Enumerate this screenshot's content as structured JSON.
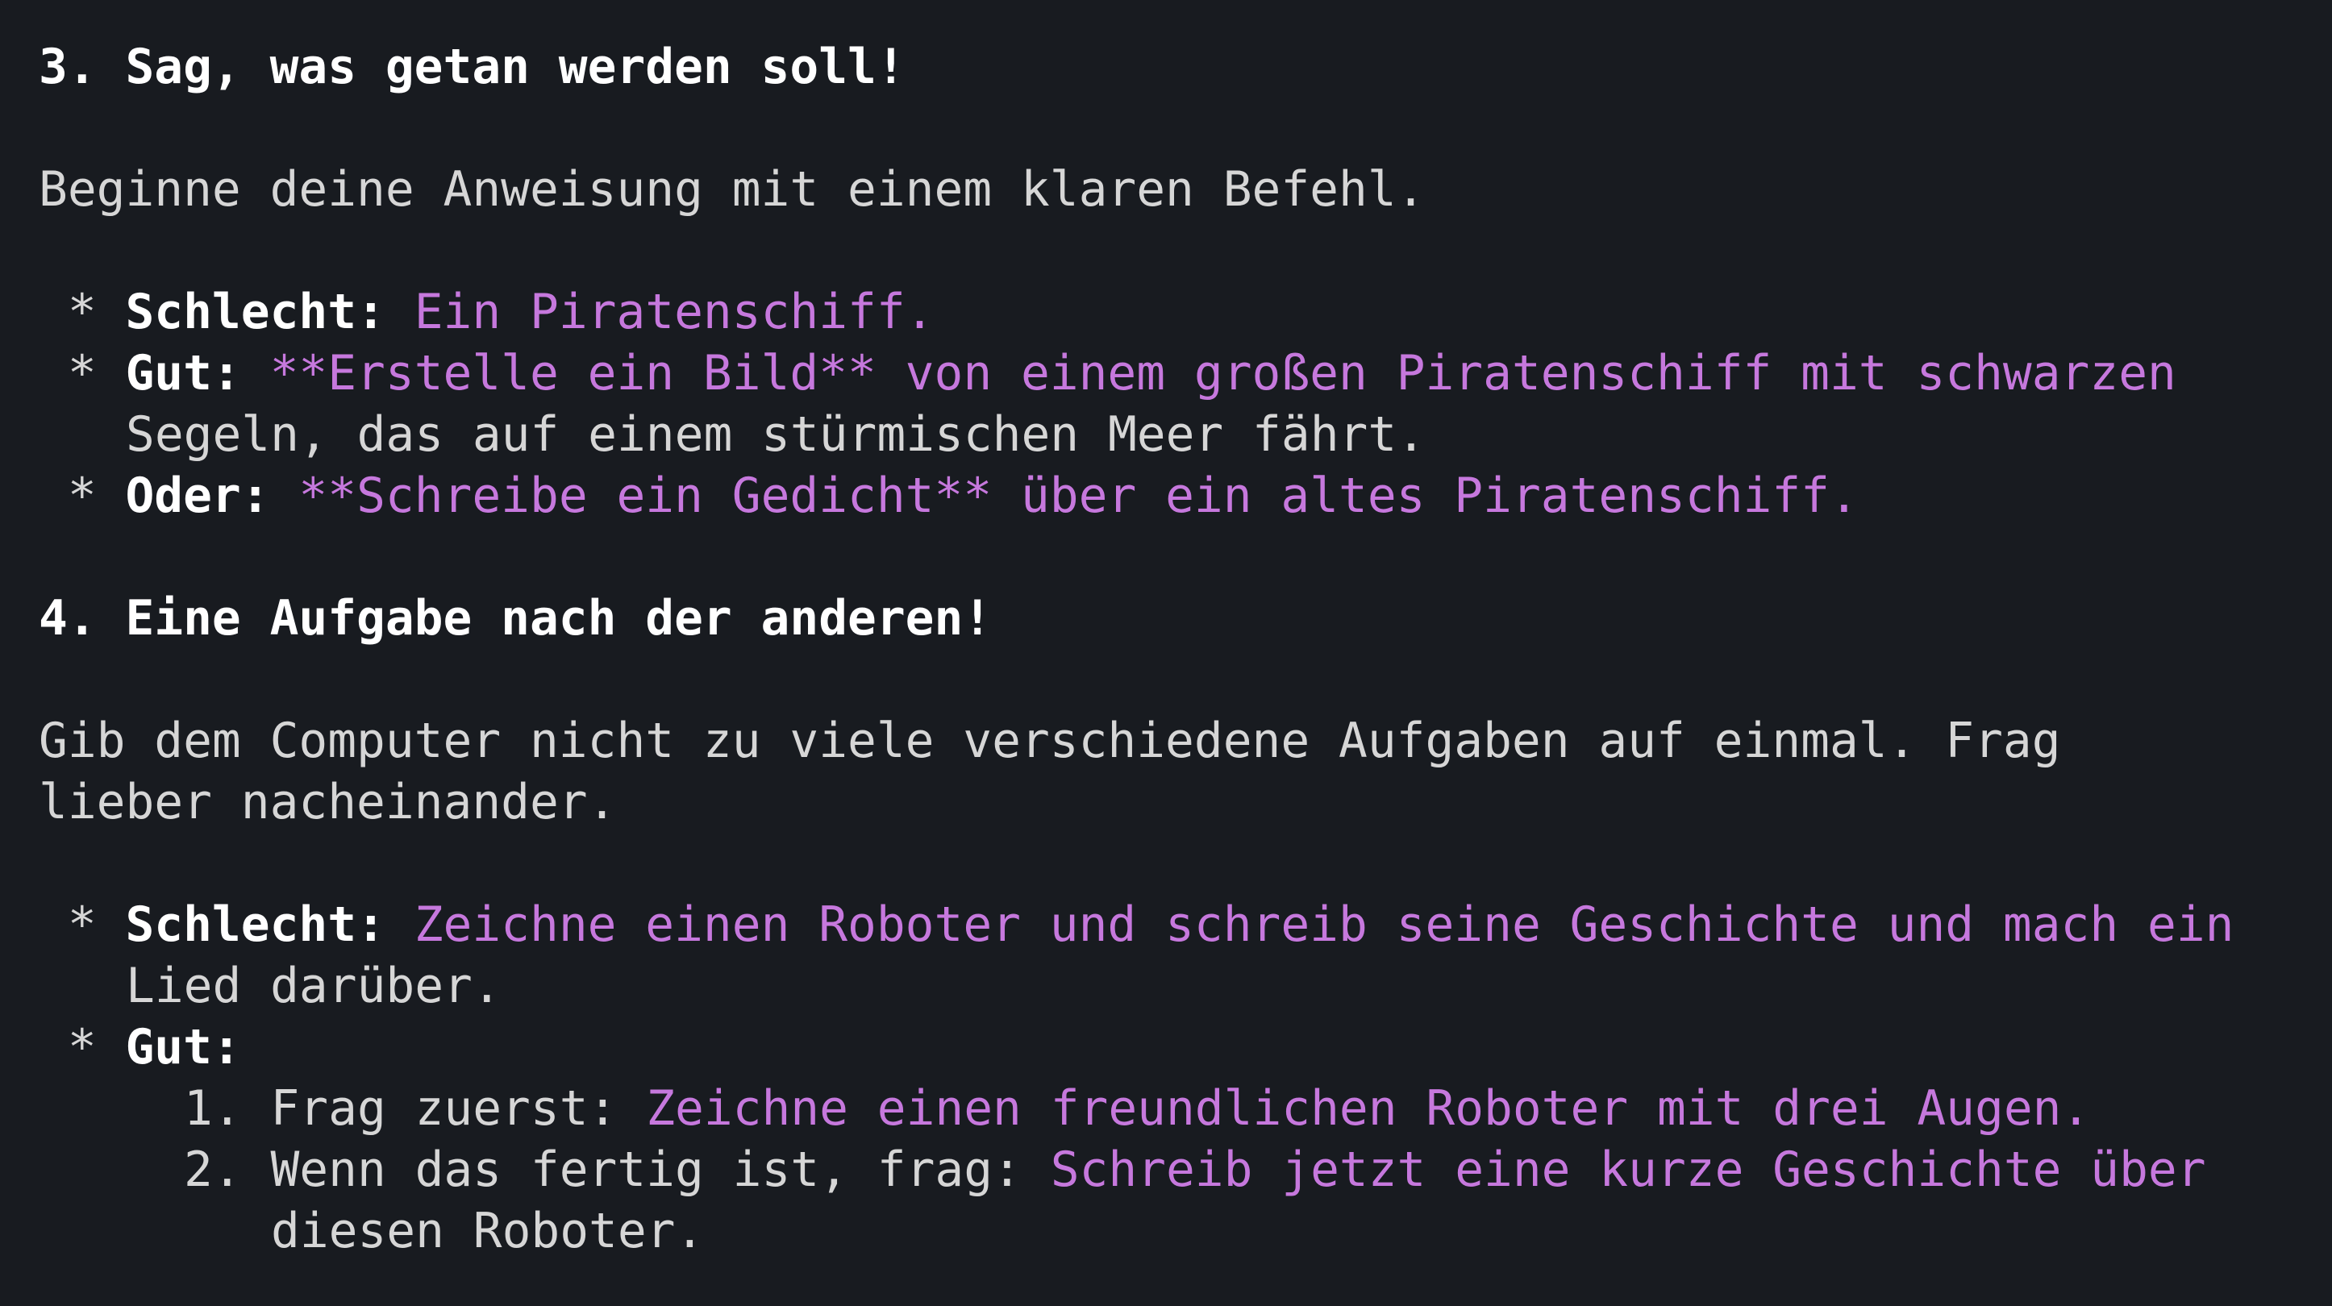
{
  "section3": {
    "heading": "3. Sag, was getan werden soll!",
    "intro": "Beginne deine Anweisung mit einem klaren Befehl.",
    "bullet": " * ",
    "bad": {
      "label": "Schlecht:",
      "example": "Ein Piratenschiff."
    },
    "good": {
      "label": "Gut:",
      "example_line1": "**Erstelle ein Bild** von einem großen Piratenschiff mit schwarzen",
      "example_line2": "Segeln, das auf einem stürmischen Meer fährt."
    },
    "or": {
      "label": "Oder:",
      "example": "**Schreibe ein Gedicht** über ein altes Piratenschiff."
    }
  },
  "section4": {
    "heading": "4. Eine Aufgabe nach der anderen!",
    "intro_line1": "Gib dem Computer nicht zu viele verschiedene Aufgaben auf einmal. Frag",
    "intro_line2": "lieber nacheinander.",
    "bullet": " * ",
    "bad": {
      "label": "Schlecht:",
      "example_line1": "Zeichne einen Roboter und schreib seine Geschichte und mach ein",
      "example_line2": "Lied darüber."
    },
    "good": {
      "label": "Gut:",
      "steps": [
        {
          "number": "1.",
          "lead": "Frag zuerst:",
          "prompt": "Zeichne einen freundlichen Roboter mit drei Augen."
        },
        {
          "number": "2.",
          "lead": "Wenn das fertig ist, frag:",
          "prompt_line1": "Schreib jetzt eine kurze Geschichte über",
          "prompt_line2": "diesen Roboter."
        }
      ]
    }
  },
  "colors": {
    "background": "#181b20",
    "text": "#d6d6d6",
    "bold_text": "#ffffff",
    "example_accent": "#c678dd"
  }
}
